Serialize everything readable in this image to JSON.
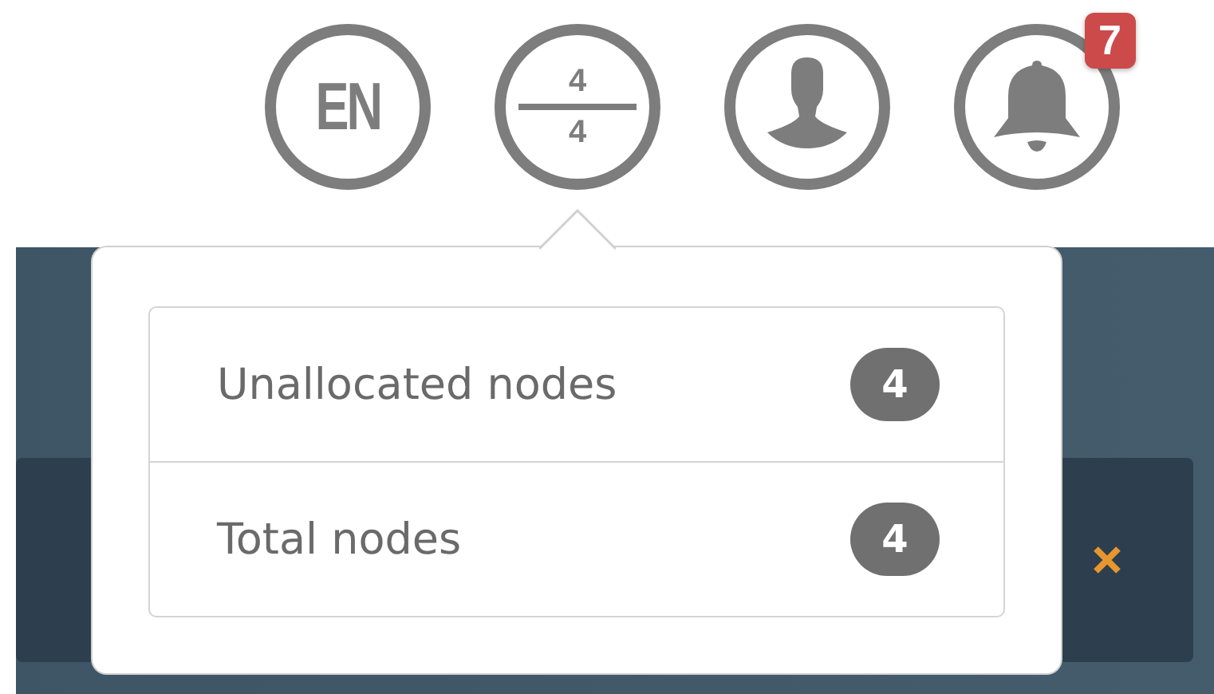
{
  "header": {
    "language": "EN",
    "nodes_fraction": {
      "numerator": "4",
      "denominator": "4"
    },
    "notifications_badge": "7"
  },
  "popover": {
    "items": [
      {
        "label": "Unallocated nodes",
        "count": "4"
      },
      {
        "label": "Total nodes",
        "count": "4"
      }
    ]
  }
}
